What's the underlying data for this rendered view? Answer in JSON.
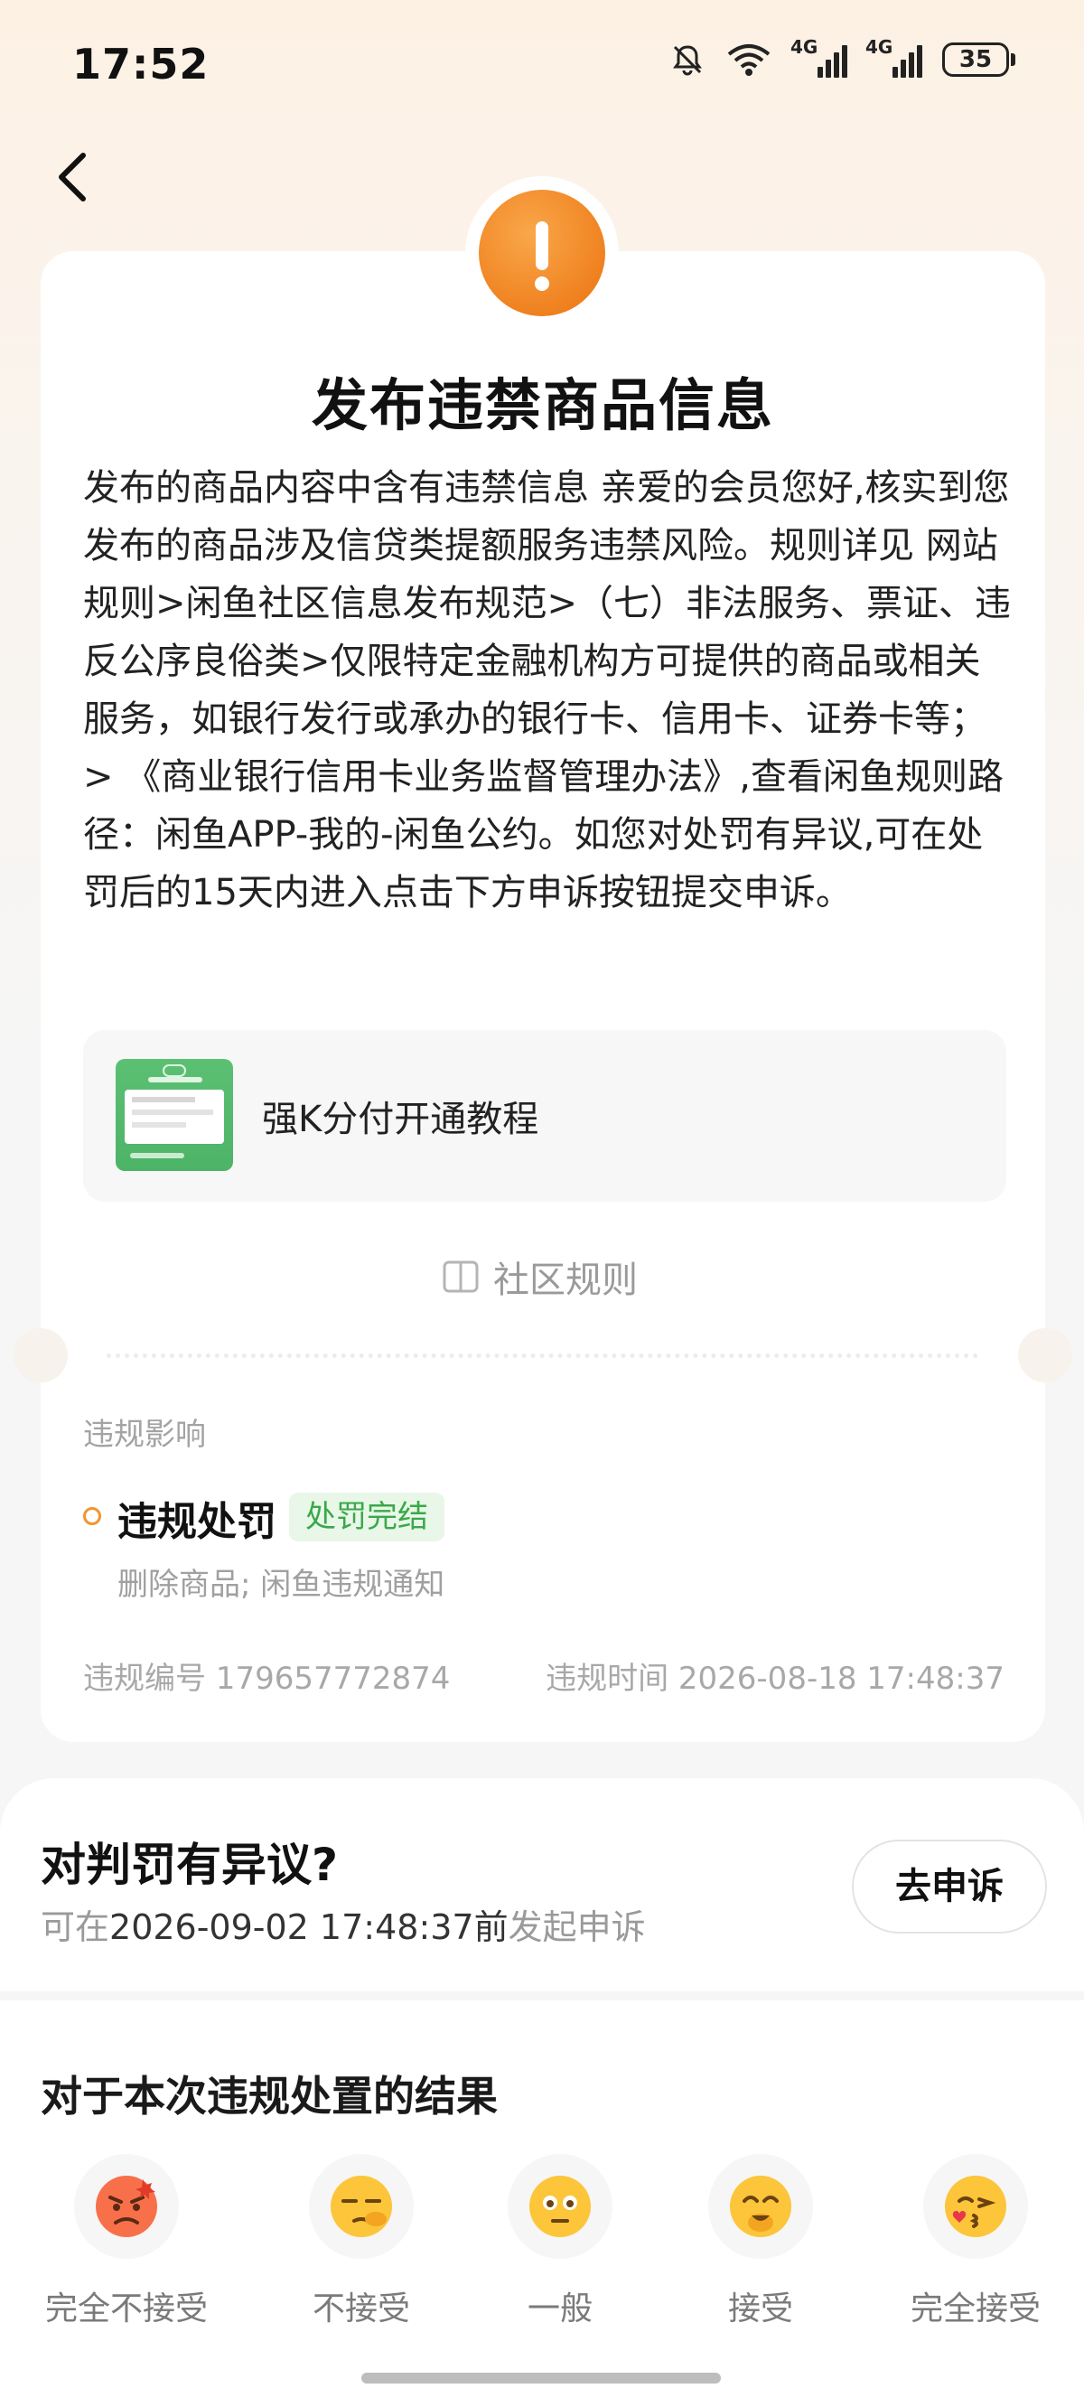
{
  "status_bar": {
    "time": "17:52",
    "signal1_label": "4G",
    "signal2_label": "4G",
    "battery": "35",
    "icons": [
      "mute-icon",
      "wifi-icon",
      "signal-icon",
      "signal-icon",
      "battery-icon"
    ]
  },
  "nav": {
    "back_icon": "chevron-left-icon"
  },
  "violation": {
    "title": "发布违禁商品信息",
    "description": "发布的商品内容中含有违禁信息 亲爱的会员您好,核实到您发布的商品涉及信贷类提额服务违禁风险。规则详见 网站规则>闲鱼社区信息发布规范>（七）非法服务、票证、违反公序良俗类>仅限特定金融机构方可提供的商品或相关服务，如银行发行或承办的银行卡、信用卡、证券卡等；> 《商业银行信用卡业务监督管理办法》,查看闲鱼规则路径：闲鱼APP-我的-闲鱼公约。如您对处罚有异议,可在处罚后的15天内进入点击下方申诉按钮提交申诉。",
    "tutorial_label": "强K分付开通教程",
    "rules_link": "社区规则",
    "impact_label": "违规影响",
    "penalty_title": "违规处罚",
    "penalty_status": "处罚完结",
    "penalty_detail": "删除商品; 闲鱼违规通知",
    "violation_no": "违规编号 179657772874",
    "violation_time": "违规时间 2026-08-18 17:48:37"
  },
  "appeal": {
    "title": "对判罚有异议?",
    "sub_prefix": "可在",
    "deadline": "2026-09-02 17:48:37前",
    "sub_suffix": "发起申诉",
    "button": "去申诉"
  },
  "feedback": {
    "title": "对于本次违规处置的结果",
    "options": [
      {
        "label": "完全不接受",
        "icon": "angry-face-icon"
      },
      {
        "label": "不接受",
        "icon": "unamused-face-icon"
      },
      {
        "label": "一般",
        "icon": "neutral-face-icon"
      },
      {
        "label": "接受",
        "icon": "smiling-face-icon"
      },
      {
        "label": "完全接受",
        "icon": "kissing-face-icon"
      }
    ]
  },
  "colors": {
    "accent_orange": "#ef7f1d",
    "status_green": "#3aa84a",
    "status_green_bg": "#e8f7e8"
  }
}
